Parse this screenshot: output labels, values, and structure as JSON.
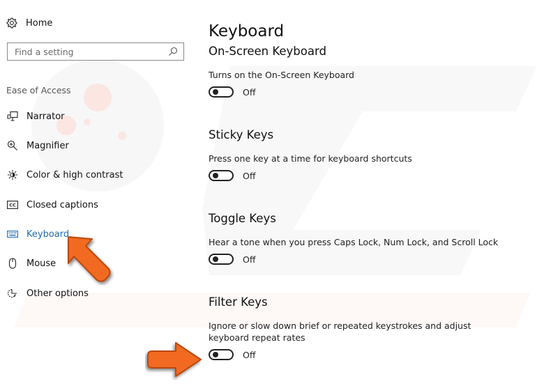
{
  "sidebar": {
    "home_label": "Home",
    "search": {
      "placeholder": "Find a setting",
      "value": ""
    },
    "section_label": "Ease of Access",
    "items": [
      {
        "label": "Narrator",
        "icon": "narrator-icon",
        "active": false
      },
      {
        "label": "Magnifier",
        "icon": "magnifier-icon",
        "active": false
      },
      {
        "label": "Color & high contrast",
        "icon": "brightness-icon",
        "active": false
      },
      {
        "label": "Closed captions",
        "icon": "closed-captions-icon",
        "active": false
      },
      {
        "label": "Keyboard",
        "icon": "keyboard-icon",
        "active": true
      },
      {
        "label": "Mouse",
        "icon": "mouse-icon",
        "active": false
      },
      {
        "label": "Other options",
        "icon": "other-options-icon",
        "active": false
      }
    ]
  },
  "main": {
    "title": "Keyboard",
    "groups": [
      {
        "heading": "On-Screen Keyboard",
        "description": "Turns on the On-Screen Keyboard",
        "toggle_state": "Off"
      },
      {
        "heading": "Sticky Keys",
        "description": "Press one key at a time for keyboard shortcuts",
        "toggle_state": "Off"
      },
      {
        "heading": "Toggle Keys",
        "description": "Hear a tone when you press Caps Lock, Num Lock, and Scroll Lock",
        "toggle_state": "Off"
      },
      {
        "heading": "Filter Keys",
        "description_line1": "Ignore or slow down brief or repeated keystrokes and adjust",
        "description_line2": "keyboard repeat rates",
        "toggle_state": "Off"
      }
    ]
  },
  "colors": {
    "accent": "#1f6cb3",
    "annotation_arrow": "#f26b21"
  }
}
